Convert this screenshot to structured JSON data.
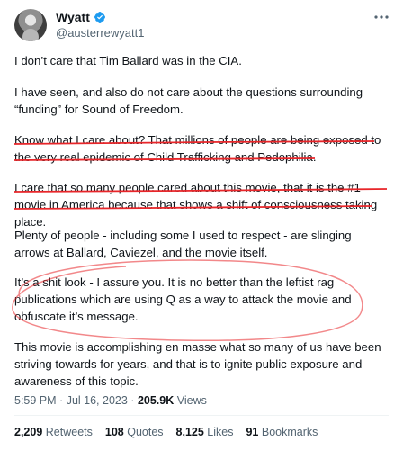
{
  "author": {
    "name": "Wyatt",
    "handle": "@austerrewyatt1",
    "verified_color": "#1d9bf0"
  },
  "tweet": {
    "paragraphs": [
      "I don’t care that Tim Ballard was in the CIA.",
      "I have seen, and also do not care about the questions surrounding “funding” for Sound of Freedom.",
      "Know what I care about? That millions of people are being exposed to the very real epidemic of Child Trafficking and Pedophilia.",
      "I care that so many people cared about this movie, that it is the #1 movie in America because that shows a shift of consciousness taking place.",
      "Plenty of people - including some I used to respect - are slinging arrows at Ballard, Caviezel, and the movie itself.",
      "It’s a shit look - I assure you. It is no better than the leftist rag publications which are using Q as a way to attack the movie and obfuscate it’s message.",
      "This movie is accomplishing en masse what so many of us have been striving towards for years, and that is to ignite public exposure and awareness of this topic."
    ]
  },
  "meta": {
    "time": "5:59 PM",
    "date": "Jul 16, 2023",
    "separator": "·",
    "views_count": "205.9K",
    "views_label": "Views"
  },
  "stats": {
    "retweets": {
      "count": "2,209",
      "label": "Retweets"
    },
    "quotes": {
      "count": "108",
      "label": "Quotes"
    },
    "likes": {
      "count": "8,125",
      "label": "Likes"
    },
    "bookmarks": {
      "count": "91",
      "label": "Bookmarks"
    }
  },
  "annotation_color": "#e8262a",
  "icons": {
    "verified": "verified-badge-icon",
    "more": "more-options-icon"
  }
}
